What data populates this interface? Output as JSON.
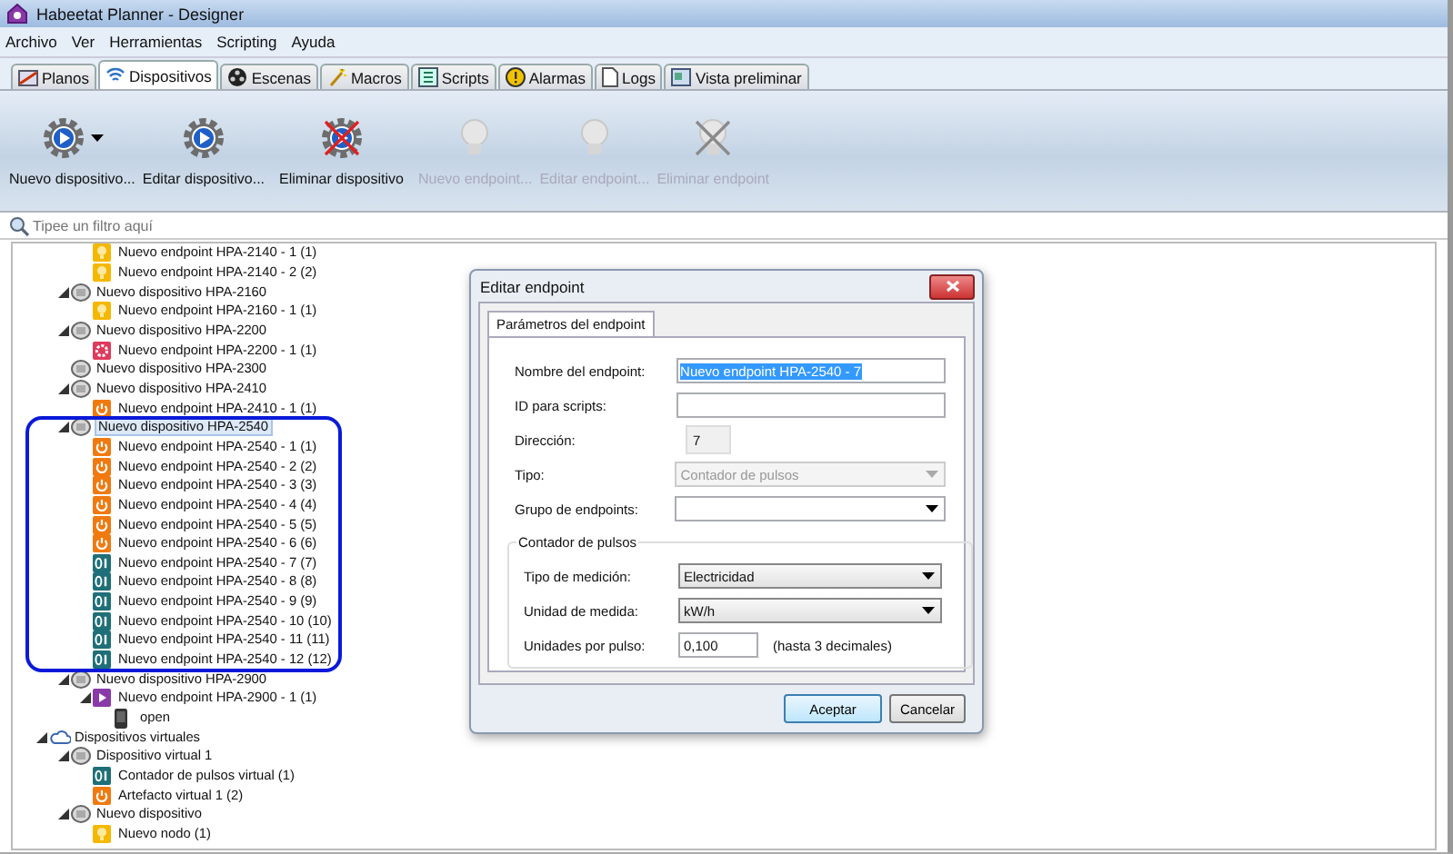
{
  "window": {
    "title": "Habeetat Planner - Designer"
  },
  "menu": [
    "Archivo",
    "Ver",
    "Herramientas",
    "Scripting",
    "Ayuda"
  ],
  "tabs": [
    {
      "label": "Planos",
      "kind": "plan",
      "selected": false
    },
    {
      "label": "Dispositivos",
      "kind": "wifi",
      "selected": true
    },
    {
      "label": "Escenas",
      "kind": "film",
      "selected": false
    },
    {
      "label": "Macros",
      "kind": "wand",
      "selected": false
    },
    {
      "label": "Scripts",
      "kind": "script",
      "selected": false
    },
    {
      "label": "Alarmas",
      "kind": "alarm",
      "selected": false
    },
    {
      "label": "Logs",
      "kind": "page",
      "selected": false
    },
    {
      "label": "Vista preliminar",
      "kind": "preview",
      "selected": false
    }
  ],
  "toolbar": [
    {
      "label": "Nuevo dispositivo...",
      "kind": "gear",
      "dropdown": true,
      "disabled": false
    },
    {
      "label": "Editar dispositivo...",
      "kind": "gear",
      "dropdown": false,
      "disabled": false
    },
    {
      "label": "Eliminar dispositivo",
      "kind": "gear-cross",
      "dropdown": false,
      "disabled": false
    },
    {
      "label": "Nuevo endpoint...",
      "kind": "bulb",
      "dropdown": false,
      "disabled": true
    },
    {
      "label": "Editar endpoint...",
      "kind": "bulb",
      "dropdown": false,
      "disabled": true
    },
    {
      "label": "Eliminar endpoint",
      "kind": "bulb-cross",
      "dropdown": false,
      "disabled": true
    }
  ],
  "filter": {
    "placeholder": "Tipee un filtro aquí"
  },
  "tree": [
    {
      "children": [
        {
          "children": [
            {
              "label": "Nuevo endpoint HPA-2140 - 1 (1)",
              "kind": "bulb",
              "selected": false
            },
            {
              "label": "Nuevo endpoint HPA-2140 - 2 (2)",
              "kind": "bulb",
              "selected": false
            }
          ]
        },
        {
          "label": "Nuevo dispositivo HPA-2160",
          "kind": "device",
          "selected": false,
          "expanded": true,
          "children": [
            {
              "label": "Nuevo endpoint HPA-2160 - 1 (1)",
              "kind": "bulb",
              "selected": false
            }
          ]
        },
        {
          "label": "Nuevo dispositivo HPA-2200",
          "kind": "device",
          "selected": false,
          "expanded": true,
          "children": [
            {
              "label": "Nuevo endpoint HPA-2200 - 1 (1)",
              "kind": "gear",
              "selected": false
            }
          ]
        },
        {
          "label": "Nuevo dispositivo HPA-2300",
          "kind": "device",
          "selected": false
        },
        {
          "label": "Nuevo dispositivo HPA-2410",
          "kind": "device",
          "selected": false,
          "expanded": true,
          "children": [
            {
              "label": "Nuevo endpoint HPA-2410 - 1 (1)",
              "kind": "power",
              "selected": false
            }
          ]
        },
        {
          "label": "Nuevo dispositivo HPA-2540",
          "kind": "device",
          "selected": true,
          "expanded": true,
          "children": [
            {
              "label": "Nuevo endpoint HPA-2540 - 1 (1)",
              "kind": "power",
              "selected": false
            },
            {
              "label": "Nuevo endpoint HPA-2540 - 2 (2)",
              "kind": "power",
              "selected": false
            },
            {
              "label": "Nuevo endpoint HPA-2540 - 3 (3)",
              "kind": "power",
              "selected": false
            },
            {
              "label": "Nuevo endpoint HPA-2540 - 4 (4)",
              "kind": "power",
              "selected": false
            },
            {
              "label": "Nuevo endpoint HPA-2540 - 5 (5)",
              "kind": "power",
              "selected": false
            },
            {
              "label": "Nuevo endpoint HPA-2540 - 6 (6)",
              "kind": "power",
              "selected": false
            },
            {
              "label": "Nuevo endpoint HPA-2540 - 7 (7)",
              "kind": "counter",
              "selected": false
            },
            {
              "label": "Nuevo endpoint HPA-2540 - 8 (8)",
              "kind": "counter",
              "selected": false
            },
            {
              "label": "Nuevo endpoint HPA-2540 - 9 (9)",
              "kind": "counter",
              "selected": false
            },
            {
              "label": "Nuevo endpoint HPA-2540 - 10 (10)",
              "kind": "counter",
              "selected": false
            },
            {
              "label": "Nuevo endpoint HPA-2540 - 11 (11)",
              "kind": "counter",
              "selected": false
            },
            {
              "label": "Nuevo endpoint HPA-2540 - 12 (12)",
              "kind": "counter",
              "selected": false
            }
          ]
        },
        {
          "label": "Nuevo dispositivo HPA-2900",
          "kind": "device",
          "selected": false,
          "expanded": true,
          "children": [
            {
              "label": "Nuevo endpoint HPA-2900 - 1 (1)",
              "kind": "play",
              "selected": false,
              "expanded": true,
              "children": [
                {
                  "label": "open",
                  "kind": "phone",
                  "selected": false
                }
              ]
            }
          ]
        }
      ]
    },
    {
      "label": "Dispositivos virtuales",
      "kind": "cloud",
      "selected": false,
      "expanded": true,
      "children": [
        {
          "label": "Dispositivo virtual 1",
          "kind": "device",
          "selected": false,
          "expanded": true,
          "children": [
            {
              "label": "Contador de pulsos virtual (1)",
              "kind": "counter",
              "selected": false
            },
            {
              "label": "Artefacto virtual 1 (2)",
              "kind": "power",
              "selected": false
            }
          ]
        },
        {
          "label": "Nuevo dispositivo",
          "kind": "device",
          "selected": false,
          "expanded": true,
          "children": [
            {
              "label": "Nuevo nodo (1)",
              "kind": "bulb",
              "selected": false
            }
          ]
        }
      ]
    }
  ],
  "dialog": {
    "title": "Editar endpoint",
    "tab": "Parámetros del endpoint",
    "fields": [
      {
        "label": "Nombre del endpoint:",
        "kind": "text",
        "value": "Nuevo endpoint HPA-2540 - 7",
        "selected": true
      },
      {
        "label": "ID para scripts:",
        "kind": "text"
      },
      {
        "label": "Dirección:",
        "kind": "readonly",
        "value": "7"
      },
      {
        "label": "Tipo:",
        "kind": "combo",
        "value": "Contador de pulsos",
        "disabled": true
      },
      {
        "label": "Grupo de endpoints:",
        "kind": "combo",
        "disabled": false
      }
    ],
    "group": {
      "title": "Contador de pulsos",
      "fields": [
        {
          "label": "Tipo de medición:",
          "kind": "combo",
          "value": "Electricidad",
          "disabled": false
        },
        {
          "label": "Unidad de medida:",
          "kind": "combo",
          "value": "kW/h",
          "disabled": false
        },
        {
          "label": "Unidades por pulso:",
          "kind": "number",
          "value": "0,100",
          "hint": "(hasta 3 decimales)"
        }
      ]
    },
    "buttons": [
      {
        "label": "Aceptar",
        "default": true
      },
      {
        "label": "Cancelar",
        "default": false
      }
    ]
  }
}
